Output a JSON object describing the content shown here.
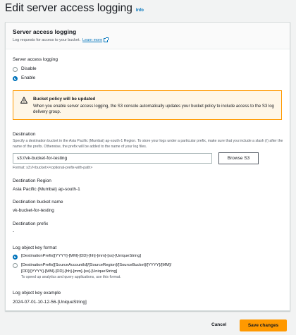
{
  "page": {
    "title": "Edit server access logging",
    "info": "Info"
  },
  "panel": {
    "title": "Server access logging",
    "description": "Log requests for access to your bucket.",
    "learn_more": "Learn more"
  },
  "logging": {
    "label": "Server access logging",
    "options": [
      {
        "label": "Disable",
        "selected": false
      },
      {
        "label": "Enable",
        "selected": true
      }
    ]
  },
  "alert": {
    "title": "Bucket policy will be updated",
    "body": "When you enable server access logging, the S3 console automatically updates your bucket policy to include access to the S3 log delivery group."
  },
  "destination": {
    "label": "Destination",
    "help": "Specify a destination bucket in the Asia Pacific (Mumbai) ap-south-1 Region. To store your logs under a particular prefix, make sure that you include a slash (/) after the name of the prefix. Otherwise, the prefix will be added to the name of your log files.",
    "value": "s3://vk-bucket-for-testing",
    "browse_label": "Browse S3",
    "format_hint": "Format: s3://<bucket>/<optional-prefix-with-path>"
  },
  "details": {
    "region_label": "Destination Region",
    "region_value": "Asia Pacific (Mumbai) ap-south-1",
    "bucket_label": "Destination bucket name",
    "bucket_value": "vk-bucket-for-testing",
    "prefix_label": "Destination prefix",
    "prefix_value": "-"
  },
  "key_format": {
    "label": "Log object key format",
    "option1": "[DestinationPrefix][YYYY]-[MM]-[DD]-[hh]-[mm]-[ss]-[UniqueString]",
    "option2_line1": "[DestinationPrefix][SourceAccountId]/[SourceRegion]/[SourceBucket]/[YYYY]/[MM]/",
    "option2_line2": "[DD]/[YYYY]-[MM]-[DD]-[hh]-[mm]-[ss]-[UniqueString]",
    "option2_hint": "To speed up analytics and query applications, use this format.",
    "selected": 0
  },
  "example": {
    "label": "Log object key example",
    "value": "2024-07-01-10-12-56-[UniqueString]"
  },
  "footer": {
    "cancel": "Cancel",
    "save": "Save changes"
  },
  "colors": {
    "accent": "#0073bb",
    "primary_button": "#ff9900",
    "alert_border": "#ff9900"
  }
}
